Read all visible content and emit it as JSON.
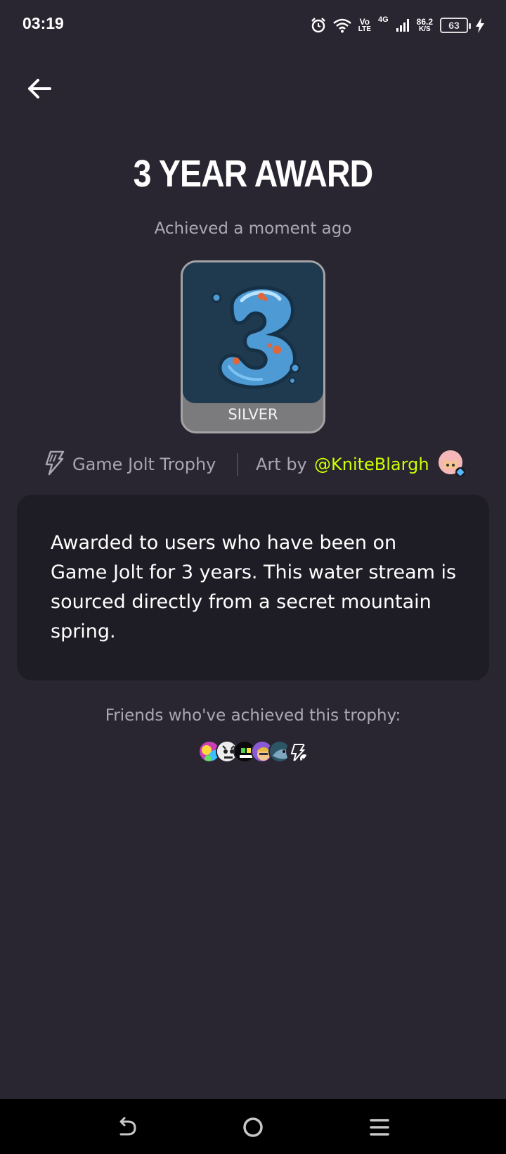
{
  "status_bar": {
    "time": "03:19",
    "volte_top": "Vo",
    "volte_bottom": "LTE",
    "network": "4G",
    "speed_value": "86.2",
    "speed_unit": "K/S",
    "battery": "63"
  },
  "trophy": {
    "title": "3 YEAR AWARD",
    "achieved": "Achieved a moment ago",
    "tier": "SILVER",
    "source": "Game Jolt Trophy",
    "art_by_label": "Art by",
    "artist": "@KniteBlargh",
    "description": "Awarded to users who have been on Game Jolt for 3 years. This water stream is sourced directly from a secret mountain spring."
  },
  "friends": {
    "label": "Friends who've achieved this trophy:",
    "avatars": [
      "friend-1",
      "friend-2",
      "friend-3",
      "friend-4",
      "friend-5",
      "friend-6"
    ]
  },
  "colors": {
    "background": "#292631",
    "card": "#1e1c24",
    "accent": "#ccff00",
    "muted_text": "#aba9b3",
    "trophy_silver": "#7b7b7d"
  },
  "icons": {
    "back": "arrow-left-icon",
    "trophy_source": "game-jolt-bolt-icon",
    "nav_back": "nav-back-icon",
    "nav_home": "nav-home-icon",
    "nav_menu": "nav-menu-icon"
  }
}
